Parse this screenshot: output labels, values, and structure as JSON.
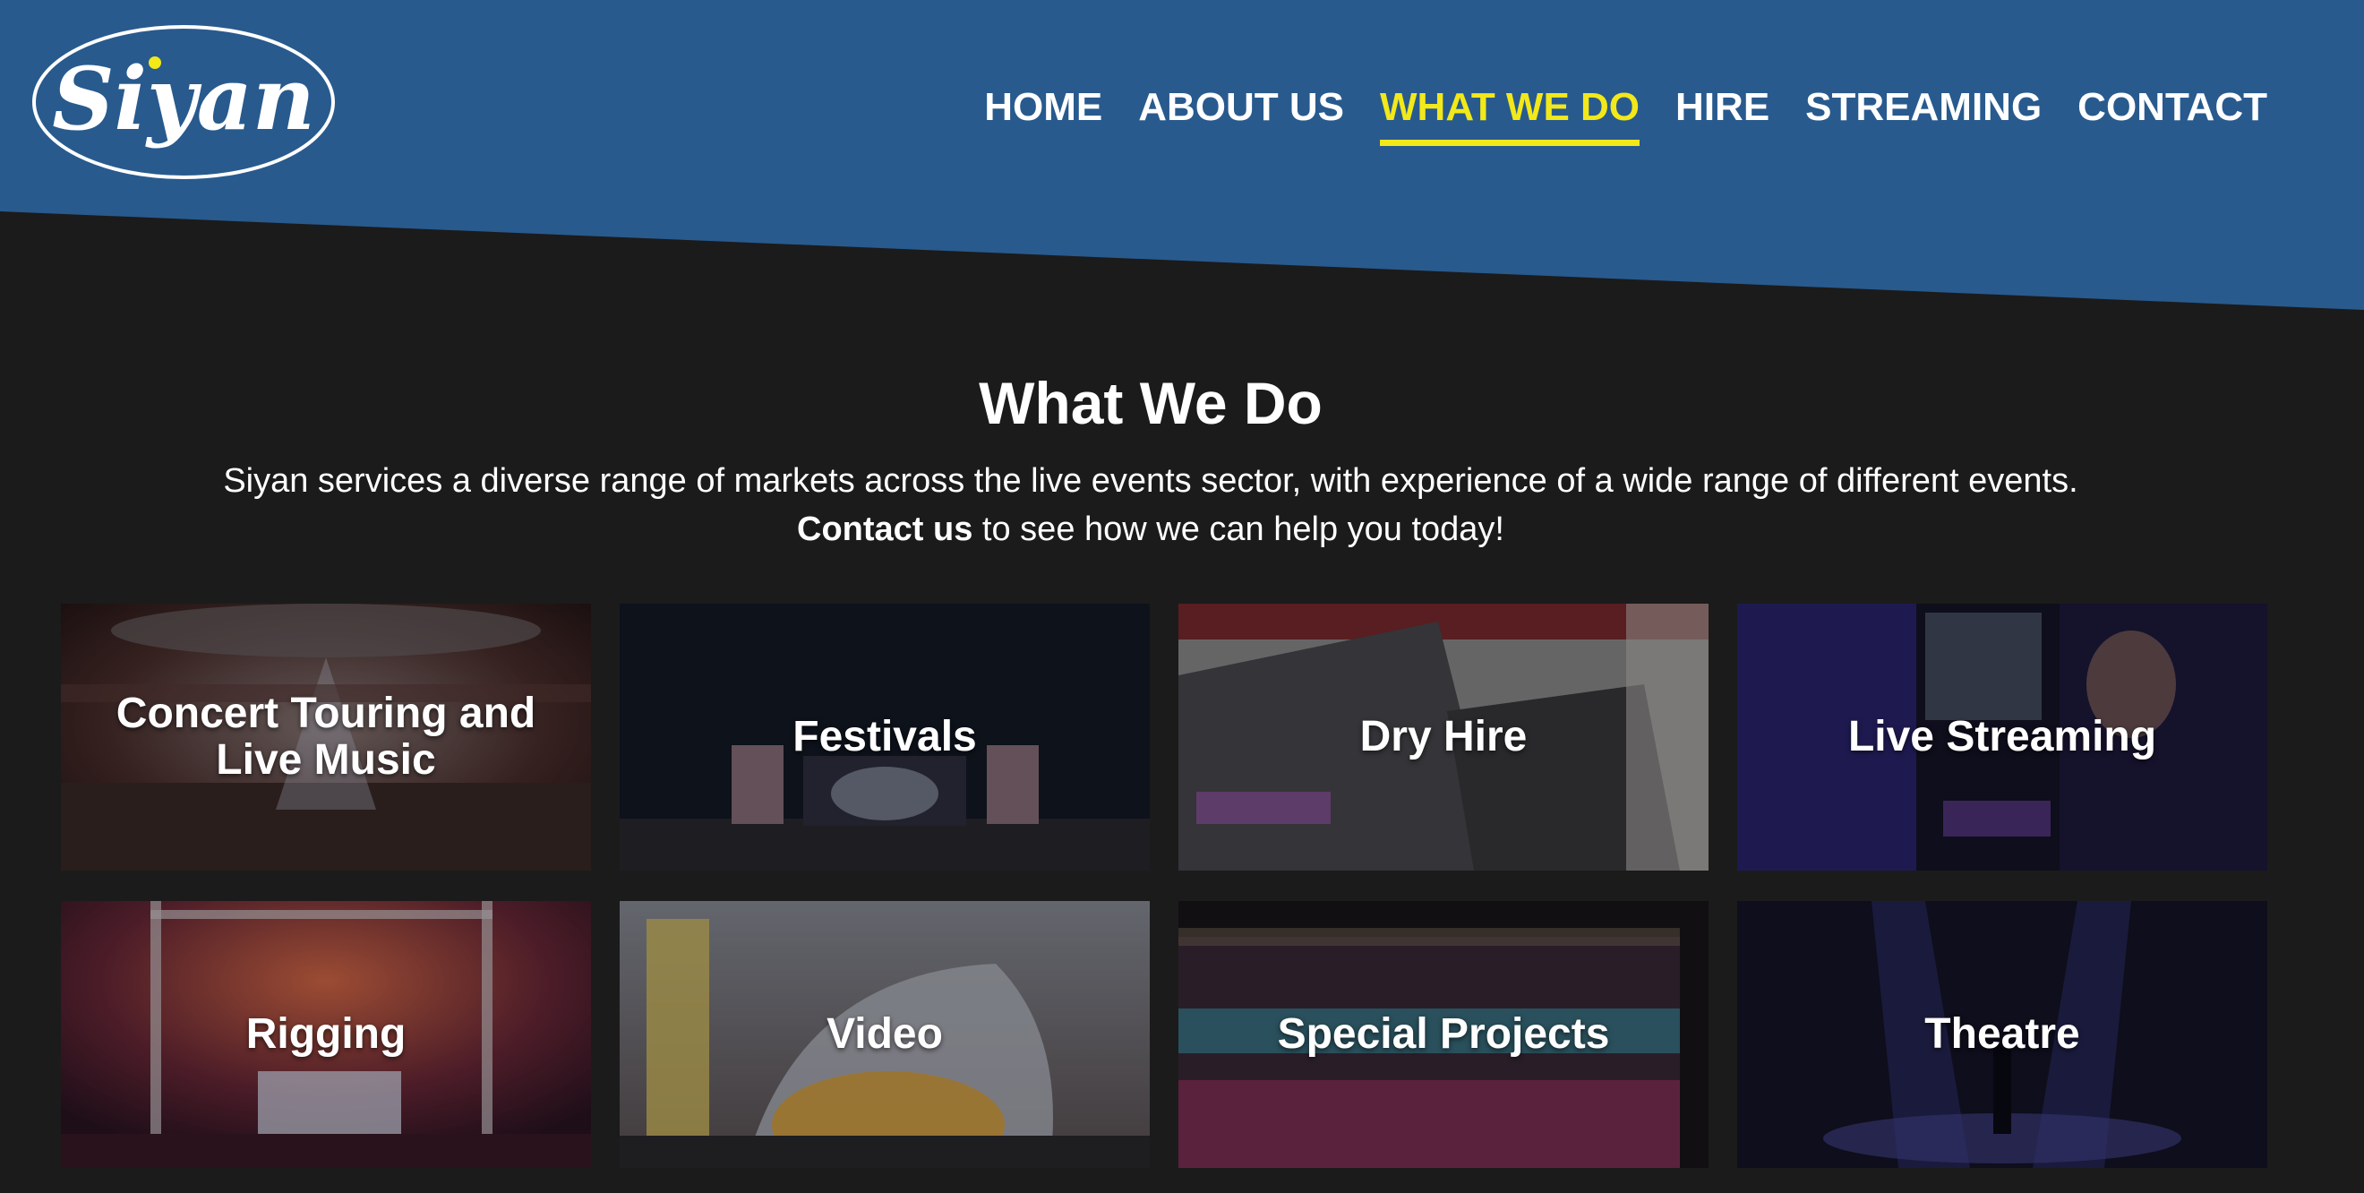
{
  "brand": {
    "logo_text": "Siyan"
  },
  "nav": {
    "items": [
      {
        "label": "HOME"
      },
      {
        "label": "ABOUT US"
      },
      {
        "label": "WHAT WE DO"
      },
      {
        "label": "HIRE"
      },
      {
        "label": "STREAMING"
      },
      {
        "label": "CONTACT"
      }
    ],
    "active": "WHAT WE DO"
  },
  "main": {
    "title": "What We Do",
    "intro_line1": "Siyan services a diverse range of markets across the live events sector, with experience of a wide range of different events.",
    "intro_link": "Contact us",
    "intro_line2_rest": " to see how we can help you today!"
  },
  "tiles": [
    {
      "label": "Concert Touring and Live Music"
    },
    {
      "label": "Festivals"
    },
    {
      "label": "Dry Hire"
    },
    {
      "label": "Live Streaming"
    },
    {
      "label": "Rigging"
    },
    {
      "label": "Video"
    },
    {
      "label": "Special Projects"
    },
    {
      "label": "Theatre"
    }
  ],
  "colors": {
    "header_blue": "#285a8e",
    "page_bg": "#1b1b1b",
    "active_yellow": "#f2e81a",
    "text_white": "#ffffff"
  }
}
